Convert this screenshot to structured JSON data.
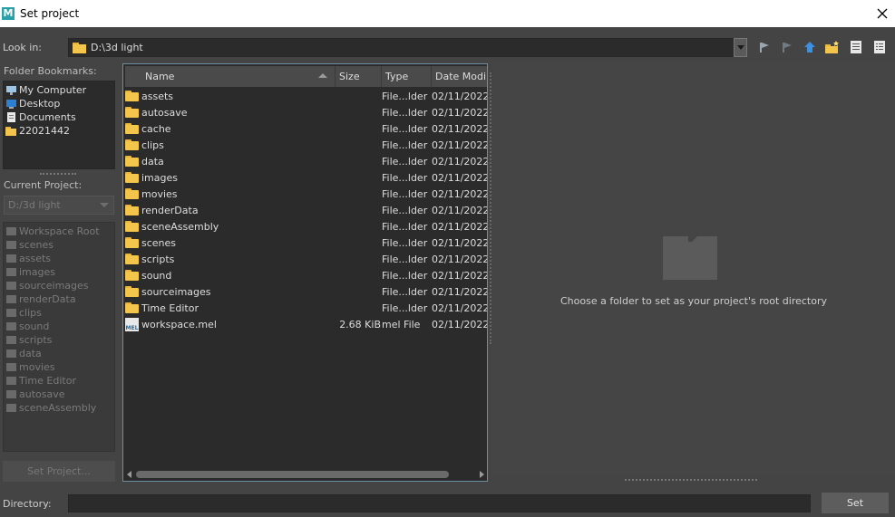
{
  "window": {
    "title": "Set project",
    "app_icon": "M"
  },
  "lookin": {
    "label": "Look in:",
    "path": "D:\\3d light",
    "toolbar_icons": [
      "back-icon",
      "forward-icon",
      "parent-directory-icon",
      "new-folder-icon",
      "list-view-icon",
      "detail-view-icon"
    ]
  },
  "bookmarks": {
    "label": "Folder Bookmarks:",
    "items": [
      {
        "label": "My Computer",
        "icon": "computer-icon"
      },
      {
        "label": "Desktop",
        "icon": "desktop-icon"
      },
      {
        "label": "Documents",
        "icon": "documents-icon"
      },
      {
        "label": "22021442",
        "icon": "folder-icon"
      }
    ]
  },
  "current_project": {
    "label": "Current Project:",
    "value": "D:/3d light",
    "workspace_items": [
      "Workspace Root",
      "scenes",
      "assets",
      "images",
      "sourceimages",
      "renderData",
      "clips",
      "sound",
      "scripts",
      "data",
      "movies",
      "Time Editor",
      "autosave",
      "sceneAssembly"
    ]
  },
  "set_project_button": "Set Project...",
  "file_list": {
    "columns": [
      "Name",
      "Size",
      "Type",
      "Date Modi"
    ],
    "rows": [
      {
        "name": "assets",
        "size": "",
        "type": "File...lder",
        "date": "02/11/2022",
        "icon": "folder"
      },
      {
        "name": "autosave",
        "size": "",
        "type": "File...lder",
        "date": "02/11/2022",
        "icon": "folder"
      },
      {
        "name": "cache",
        "size": "",
        "type": "File...lder",
        "date": "02/11/2022",
        "icon": "folder"
      },
      {
        "name": "clips",
        "size": "",
        "type": "File...lder",
        "date": "02/11/2022",
        "icon": "folder"
      },
      {
        "name": "data",
        "size": "",
        "type": "File...lder",
        "date": "02/11/2022",
        "icon": "folder"
      },
      {
        "name": "images",
        "size": "",
        "type": "File...lder",
        "date": "02/11/2022",
        "icon": "folder"
      },
      {
        "name": "movies",
        "size": "",
        "type": "File...lder",
        "date": "02/11/2022",
        "icon": "folder"
      },
      {
        "name": "renderData",
        "size": "",
        "type": "File...lder",
        "date": "02/11/2022",
        "icon": "folder"
      },
      {
        "name": "sceneAssembly",
        "size": "",
        "type": "File...lder",
        "date": "02/11/2022",
        "icon": "folder"
      },
      {
        "name": "scenes",
        "size": "",
        "type": "File...lder",
        "date": "02/11/2022",
        "icon": "folder"
      },
      {
        "name": "scripts",
        "size": "",
        "type": "File...lder",
        "date": "02/11/2022",
        "icon": "folder"
      },
      {
        "name": "sound",
        "size": "",
        "type": "File...lder",
        "date": "02/11/2022",
        "icon": "folder"
      },
      {
        "name": "sourceimages",
        "size": "",
        "type": "File...lder",
        "date": "02/11/2022",
        "icon": "folder"
      },
      {
        "name": "Time Editor",
        "size": "",
        "type": "File...lder",
        "date": "02/11/2022",
        "icon": "folder"
      },
      {
        "name": "workspace.mel",
        "size": "2.68 KiB",
        "type": "mel File",
        "date": "02/11/2022",
        "icon": "mel-file"
      }
    ]
  },
  "preview": {
    "message": "Choose a folder to set as your project's root directory"
  },
  "directory": {
    "label": "Directory:",
    "value": ""
  },
  "set_button": "Set"
}
